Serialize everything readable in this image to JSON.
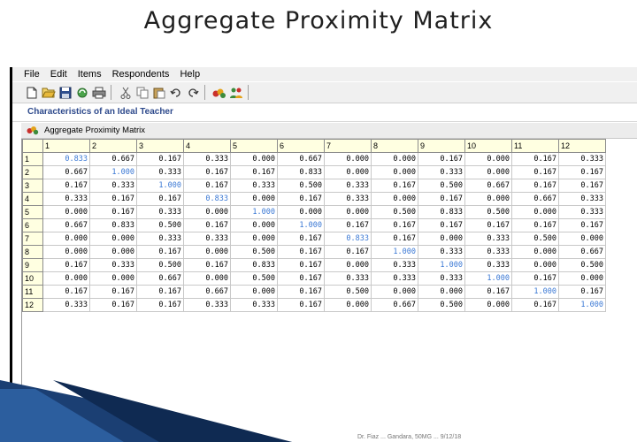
{
  "slide": {
    "title": "Aggregate Proximity Matrix",
    "footer": "Dr. Fiaz ... Gandara, 50MG ... 9/12/18"
  },
  "menu": [
    "File",
    "Edit",
    "Items",
    "Respondents",
    "Help"
  ],
  "toolbar": [
    "new-file-icon",
    "open-folder-icon",
    "save-icon",
    "recycle-icon",
    "print-icon",
    "cut-icon",
    "copy-icon",
    "paste-icon",
    "undo-icon",
    "redo-icon",
    "cluster-icon",
    "respondents-icon"
  ],
  "project_title": "Characteristics of an Ideal Teacher",
  "subwindow_title": "Aggregate Proximity Matrix",
  "matrix": {
    "col_headers": [
      "1",
      "2",
      "3",
      "4",
      "5",
      "6",
      "7",
      "8",
      "9",
      "10",
      "11",
      "12"
    ],
    "rows": [
      {
        "label": "1",
        "values": [
          "0.833",
          "0.667",
          "0.167",
          "0.333",
          "0.000",
          "0.667",
          "0.000",
          "0.000",
          "0.167",
          "0.000",
          "0.167",
          "0.333"
        ]
      },
      {
        "label": "2",
        "values": [
          "0.667",
          "1.000",
          "0.333",
          "0.167",
          "0.167",
          "0.833",
          "0.000",
          "0.000",
          "0.333",
          "0.000",
          "0.167",
          "0.167"
        ]
      },
      {
        "label": "3",
        "values": [
          "0.167",
          "0.333",
          "1.000",
          "0.167",
          "0.333",
          "0.500",
          "0.333",
          "0.167",
          "0.500",
          "0.667",
          "0.167",
          "0.167"
        ]
      },
      {
        "label": "4",
        "values": [
          "0.333",
          "0.167",
          "0.167",
          "0.833",
          "0.000",
          "0.167",
          "0.333",
          "0.000",
          "0.167",
          "0.000",
          "0.667",
          "0.333"
        ]
      },
      {
        "label": "5",
        "values": [
          "0.000",
          "0.167",
          "0.333",
          "0.000",
          "1.000",
          "0.000",
          "0.000",
          "0.500",
          "0.833",
          "0.500",
          "0.000",
          "0.333"
        ]
      },
      {
        "label": "6",
        "values": [
          "0.667",
          "0.833",
          "0.500",
          "0.167",
          "0.000",
          "1.000",
          "0.167",
          "0.167",
          "0.167",
          "0.167",
          "0.167",
          "0.167"
        ]
      },
      {
        "label": "7",
        "values": [
          "0.000",
          "0.000",
          "0.333",
          "0.333",
          "0.000",
          "0.167",
          "0.833",
          "0.167",
          "0.000",
          "0.333",
          "0.500",
          "0.000"
        ]
      },
      {
        "label": "8",
        "values": [
          "0.000",
          "0.000",
          "0.167",
          "0.000",
          "0.500",
          "0.167",
          "0.167",
          "1.000",
          "0.333",
          "0.333",
          "0.000",
          "0.667"
        ]
      },
      {
        "label": "9",
        "values": [
          "0.167",
          "0.333",
          "0.500",
          "0.167",
          "0.833",
          "0.167",
          "0.000",
          "0.333",
          "1.000",
          "0.333",
          "0.000",
          "0.500"
        ]
      },
      {
        "label": "10",
        "values": [
          "0.000",
          "0.000",
          "0.667",
          "0.000",
          "0.500",
          "0.167",
          "0.333",
          "0.333",
          "0.333",
          "1.000",
          "0.167",
          "0.000"
        ]
      },
      {
        "label": "11",
        "values": [
          "0.167",
          "0.167",
          "0.167",
          "0.667",
          "0.000",
          "0.167",
          "0.500",
          "0.000",
          "0.000",
          "0.167",
          "1.000",
          "0.167"
        ]
      },
      {
        "label": "12",
        "values": [
          "0.333",
          "0.167",
          "0.167",
          "0.333",
          "0.333",
          "0.167",
          "0.000",
          "0.667",
          "0.500",
          "0.000",
          "0.167",
          "1.000"
        ]
      }
    ]
  },
  "colors": {
    "diagonal": "#3a78d4",
    "header_bg": "#ffffe1",
    "project_title": "#2e4a8c"
  }
}
